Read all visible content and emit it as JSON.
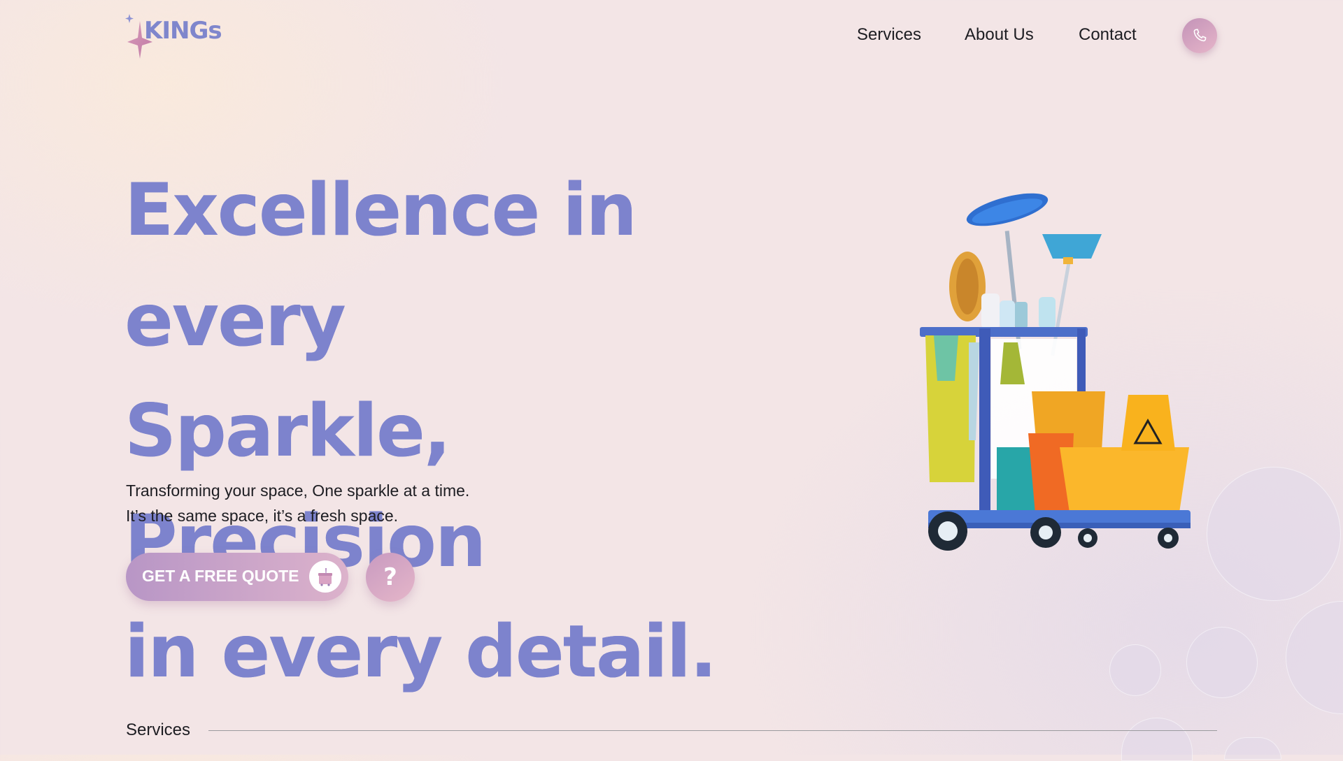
{
  "brand": {
    "name": "KINGs",
    "logo_icon": "sparkle-star-icon"
  },
  "nav": {
    "items": [
      {
        "label": "Services"
      },
      {
        "label": "About Us"
      },
      {
        "label": "Contact"
      }
    ],
    "phone_icon": "phone-icon"
  },
  "hero": {
    "title_lines": [
      "Excellence in every",
      "Sparkle, Precision",
      "in every detail."
    ],
    "subtitle_lines": [
      "Transforming your space, One sparkle at a time.",
      "It’s the same space, it’s a fresh space."
    ],
    "cta_label": "GET A FREE QUOTE",
    "cta_icon": "cleaning-bucket-icon",
    "help_label": "?",
    "illustration": "cleaning-cart-illustration"
  },
  "sections": {
    "services_heading": "Services"
  },
  "colors": {
    "accent": "#7d83cd",
    "button_gradient_start": "#b896c6",
    "button_gradient_end": "#dcb2cb",
    "background": "#f3e5e6"
  }
}
